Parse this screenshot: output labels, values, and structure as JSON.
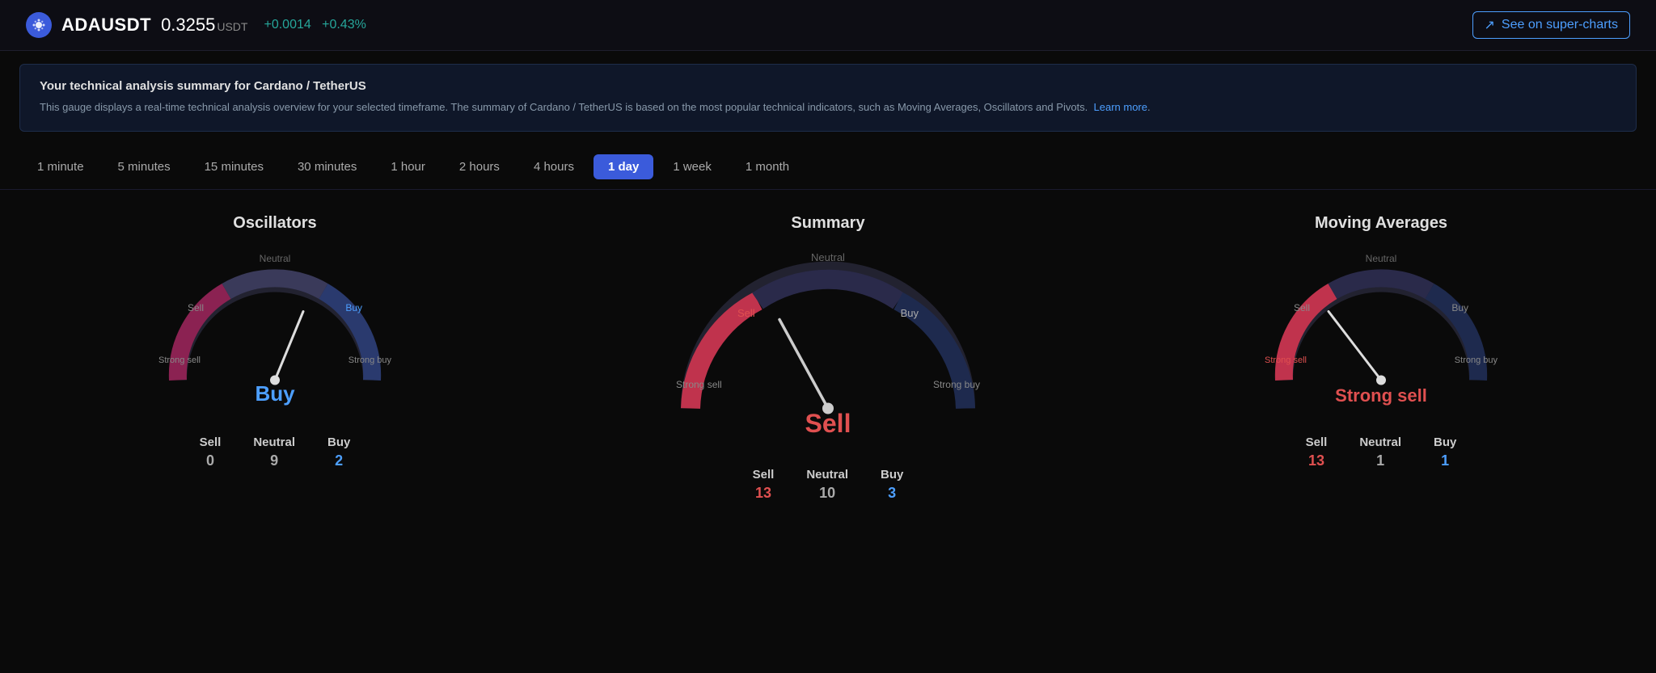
{
  "header": {
    "symbol": "ADAUSDT",
    "price": "0.3255",
    "unit": "USDT",
    "change_abs": "+0.0014",
    "change_pct": "+0.43%",
    "super_charts_label": "See on super-charts",
    "logo_icon": "₳"
  },
  "banner": {
    "title": "Your technical analysis summary for Cardano / TetherUS",
    "description": "This gauge displays a real-time technical analysis overview for your selected timeframe. The summary of Cardano / TetherUS is based on the most popular technical indicators, such as Moving Averages, Oscillators and Pivots.",
    "link_text": "Learn more",
    "link_href": "#"
  },
  "timeframes": [
    {
      "label": "1 minute",
      "id": "1m",
      "active": false
    },
    {
      "label": "5 minutes",
      "id": "5m",
      "active": false
    },
    {
      "label": "15 minutes",
      "id": "15m",
      "active": false
    },
    {
      "label": "30 minutes",
      "id": "30m",
      "active": false
    },
    {
      "label": "1 hour",
      "id": "1h",
      "active": false
    },
    {
      "label": "2 hours",
      "id": "2h",
      "active": false
    },
    {
      "label": "4 hours",
      "id": "4h",
      "active": false
    },
    {
      "label": "1 day",
      "id": "1d",
      "active": true
    },
    {
      "label": "1 week",
      "id": "1w",
      "active": false
    },
    {
      "label": "1 month",
      "id": "1mo",
      "active": false
    }
  ],
  "oscillators": {
    "title": "Oscillators",
    "signal": "Buy",
    "signal_class": "buy",
    "needle_angle": -20,
    "stats": [
      {
        "label": "Sell",
        "value": "0",
        "color": "gray"
      },
      {
        "label": "Neutral",
        "value": "9",
        "color": "gray"
      },
      {
        "label": "Buy",
        "value": "2",
        "color": "blue"
      }
    ]
  },
  "summary": {
    "title": "Summary",
    "signal": "Sell",
    "signal_class": "sell",
    "needle_angle": -60,
    "stats": [
      {
        "label": "Sell",
        "value": "13",
        "color": "red"
      },
      {
        "label": "Neutral",
        "value": "10",
        "color": "gray"
      },
      {
        "label": "Buy",
        "value": "3",
        "color": "blue"
      }
    ]
  },
  "moving_averages": {
    "title": "Moving Averages",
    "signal": "Strong sell",
    "signal_class": "strong-sell",
    "needle_angle": -75,
    "stats": [
      {
        "label": "Sell",
        "value": "13",
        "color": "red"
      },
      {
        "label": "Neutral",
        "value": "1",
        "color": "gray"
      },
      {
        "label": "Buy",
        "value": "1",
        "color": "blue"
      }
    ]
  },
  "gauge_labels": {
    "neutral": "Neutral",
    "sell": "Sell",
    "buy": "Buy",
    "strong_sell": "Strong sell",
    "strong_buy": "Strong buy"
  }
}
